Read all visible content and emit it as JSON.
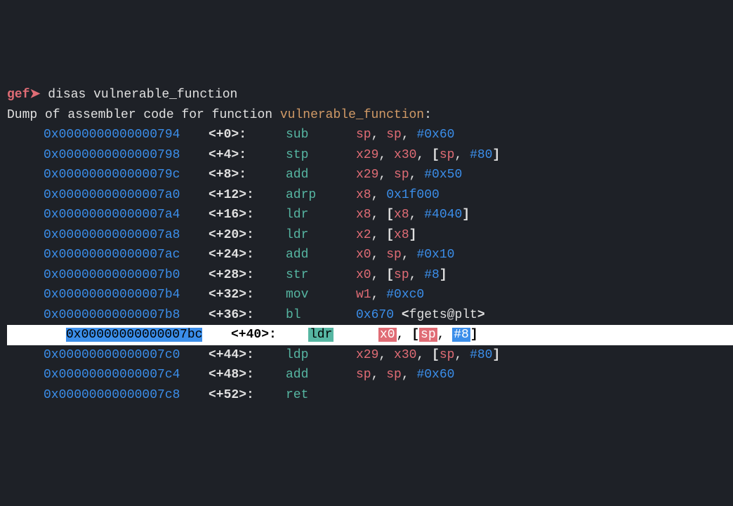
{
  "prompt": "gef➤",
  "command": "disas vulnerable_function",
  "header_prefix": "Dump of assembler code for function ",
  "function_name": "vulnerable_function",
  "header_suffix": ":",
  "rows": [
    {
      "addr": "0x0000000000000794",
      "off": "<+0>:",
      "mn": "sub",
      "ops": [
        {
          "t": "reg",
          "v": "sp"
        },
        {
          "t": "p",
          "v": ", "
        },
        {
          "t": "reg",
          "v": "sp"
        },
        {
          "t": "p",
          "v": ", "
        },
        {
          "t": "num",
          "v": "#0x60"
        }
      ]
    },
    {
      "addr": "0x0000000000000798",
      "off": "<+4>:",
      "mn": "stp",
      "ops": [
        {
          "t": "reg",
          "v": "x29"
        },
        {
          "t": "p",
          "v": ", "
        },
        {
          "t": "reg",
          "v": "x30"
        },
        {
          "t": "p",
          "v": ", "
        },
        {
          "t": "paren",
          "v": "["
        },
        {
          "t": "reg",
          "v": "sp"
        },
        {
          "t": "p",
          "v": ", "
        },
        {
          "t": "num",
          "v": "#80"
        },
        {
          "t": "paren",
          "v": "]"
        }
      ]
    },
    {
      "addr": "0x000000000000079c",
      "off": "<+8>:",
      "mn": "add",
      "ops": [
        {
          "t": "reg",
          "v": "x29"
        },
        {
          "t": "p",
          "v": ", "
        },
        {
          "t": "reg",
          "v": "sp"
        },
        {
          "t": "p",
          "v": ", "
        },
        {
          "t": "num",
          "v": "#0x50"
        }
      ]
    },
    {
      "addr": "0x00000000000007a0",
      "off": "<+12>:",
      "mn": "adrp",
      "ops": [
        {
          "t": "reg",
          "v": "x8"
        },
        {
          "t": "p",
          "v": ", "
        },
        {
          "t": "num",
          "v": "0x1f000"
        }
      ]
    },
    {
      "addr": "0x00000000000007a4",
      "off": "<+16>:",
      "mn": "ldr",
      "ops": [
        {
          "t": "reg",
          "v": "x8"
        },
        {
          "t": "p",
          "v": ", "
        },
        {
          "t": "paren",
          "v": "["
        },
        {
          "t": "reg",
          "v": "x8"
        },
        {
          "t": "p",
          "v": ", "
        },
        {
          "t": "num",
          "v": "#4040"
        },
        {
          "t": "paren",
          "v": "]"
        }
      ]
    },
    {
      "addr": "0x00000000000007a8",
      "off": "<+20>:",
      "mn": "ldr",
      "ops": [
        {
          "t": "reg",
          "v": "x2"
        },
        {
          "t": "p",
          "v": ", "
        },
        {
          "t": "paren",
          "v": "["
        },
        {
          "t": "reg",
          "v": "x8"
        },
        {
          "t": "paren",
          "v": "]"
        }
      ]
    },
    {
      "addr": "0x00000000000007ac",
      "off": "<+24>:",
      "mn": "add",
      "ops": [
        {
          "t": "reg",
          "v": "x0"
        },
        {
          "t": "p",
          "v": ", "
        },
        {
          "t": "reg",
          "v": "sp"
        },
        {
          "t": "p",
          "v": ", "
        },
        {
          "t": "num",
          "v": "#0x10"
        }
      ]
    },
    {
      "addr": "0x00000000000007b0",
      "off": "<+28>:",
      "mn": "str",
      "ops": [
        {
          "t": "reg",
          "v": "x0"
        },
        {
          "t": "p",
          "v": ", "
        },
        {
          "t": "paren",
          "v": "["
        },
        {
          "t": "reg",
          "v": "sp"
        },
        {
          "t": "p",
          "v": ", "
        },
        {
          "t": "num",
          "v": "#8"
        },
        {
          "t": "paren",
          "v": "]"
        }
      ]
    },
    {
      "addr": "0x00000000000007b4",
      "off": "<+32>:",
      "mn": "mov",
      "ops": [
        {
          "t": "reg",
          "v": "w1"
        },
        {
          "t": "p",
          "v": ", "
        },
        {
          "t": "num",
          "v": "#0xc0"
        }
      ]
    },
    {
      "addr": "0x00000000000007b8",
      "off": "<+36>:",
      "mn": "bl",
      "ops": [
        {
          "t": "num",
          "v": "0x670"
        },
        {
          "t": "p",
          "v": " "
        },
        {
          "t": "paren",
          "v": "<"
        },
        {
          "t": "white",
          "v": "fgets@plt"
        },
        {
          "t": "paren",
          "v": ">"
        }
      ]
    },
    {
      "addr": "0x00000000000007bc",
      "off": "<+40>:",
      "mn": "ldr",
      "hl": true,
      "ops": [
        {
          "t": "reg",
          "v": "x0"
        },
        {
          "t": "p",
          "v": ", "
        },
        {
          "t": "paren",
          "v": "["
        },
        {
          "t": "reg",
          "v": "sp"
        },
        {
          "t": "p",
          "v": ", "
        },
        {
          "t": "num",
          "v": "#8"
        },
        {
          "t": "paren",
          "v": "]"
        }
      ]
    },
    {
      "addr": "0x00000000000007c0",
      "off": "<+44>:",
      "mn": "ldp",
      "ops": [
        {
          "t": "reg",
          "v": "x29"
        },
        {
          "t": "p",
          "v": ", "
        },
        {
          "t": "reg",
          "v": "x30"
        },
        {
          "t": "p",
          "v": ", "
        },
        {
          "t": "paren",
          "v": "["
        },
        {
          "t": "reg",
          "v": "sp"
        },
        {
          "t": "p",
          "v": ", "
        },
        {
          "t": "num",
          "v": "#80"
        },
        {
          "t": "paren",
          "v": "]"
        }
      ]
    },
    {
      "addr": "0x00000000000007c4",
      "off": "<+48>:",
      "mn": "add",
      "ops": [
        {
          "t": "reg",
          "v": "sp"
        },
        {
          "t": "p",
          "v": ", "
        },
        {
          "t": "reg",
          "v": "sp"
        },
        {
          "t": "p",
          "v": ", "
        },
        {
          "t": "num",
          "v": "#0x60"
        }
      ]
    },
    {
      "addr": "0x00000000000007c8",
      "off": "<+52>:",
      "mn": "ret",
      "ops": []
    }
  ]
}
